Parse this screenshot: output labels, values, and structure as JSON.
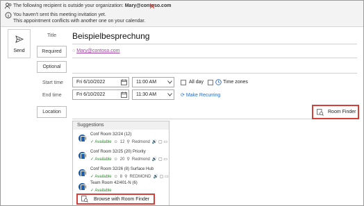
{
  "infobar": {
    "recipient_notice": "The following recipient is outside your organization:",
    "recipient_email": "Mary@contoso.com",
    "not_sent": "You haven't sent this meeting invitation yet.",
    "conflict": "This appointment conflicts with another one on your calendar."
  },
  "send": {
    "label": "Send"
  },
  "form": {
    "title_label": "Title",
    "title_value": "Beispielbesprechung",
    "required_button": "Required",
    "required_value": "Mary@contoso.com",
    "optional_button": "Optional",
    "start_label": "Start time",
    "start_date": "Fri 6/10/2022",
    "start_time": "11:00 AM",
    "allday_label": "All day",
    "timezones_label": "Time zones",
    "end_label": "End time",
    "end_date": "Fri 6/10/2022",
    "end_time": "11:30 AM",
    "recurring_label": "Make Recurring",
    "location_button": "Location"
  },
  "room_finder": {
    "label": "Room Finder"
  },
  "suggestions": {
    "header": "Suggestions",
    "rooms": [
      {
        "name": "Conf Room 32/24 (12)",
        "status": "Available",
        "capacity": "12",
        "location": "Redmond"
      },
      {
        "name": "Conf Room 32/25 (20) Priority",
        "status": "Available",
        "capacity": "20",
        "location": "Redmond"
      },
      {
        "name": "Conf Room 32/26 (8) Surface Hub",
        "status": "Available",
        "capacity": "8",
        "location": "REDMOND"
      },
      {
        "name": "Team Room 42/401-N (6)",
        "status": "Available"
      }
    ],
    "browse_label": "Browse with Room Finder"
  },
  "colors": {
    "accent": "#2b6cc4",
    "highlight": "#d43f3a",
    "available": "#2a8a2a"
  }
}
